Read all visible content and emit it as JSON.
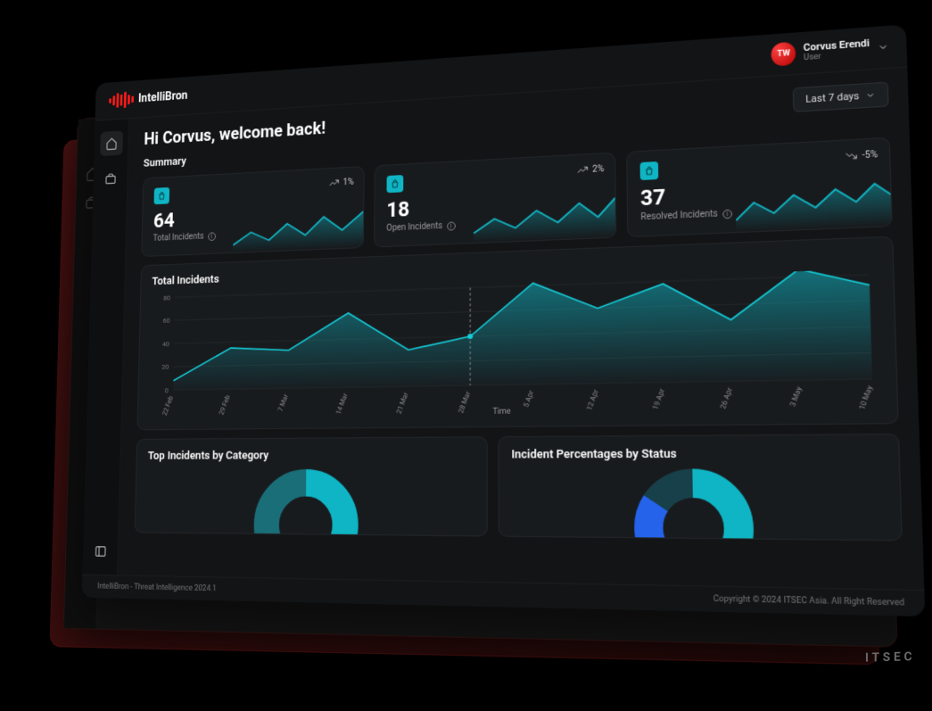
{
  "brand": {
    "name": "IntelliBron"
  },
  "user": {
    "initials": "TW",
    "name": "Corvus Erendi",
    "role": "User"
  },
  "range": {
    "label": "Last 7 days"
  },
  "welcome": "Hi Corvus, welcome back!",
  "summary": {
    "heading": "Summary",
    "cards": [
      {
        "value": "64",
        "label": "Total Incidents",
        "trend": "1%",
        "trend_dir": "up"
      },
      {
        "value": "18",
        "label": "Open Incidents",
        "trend": "2%",
        "trend_dir": "up"
      },
      {
        "value": "37",
        "label": "Resolved Incidents",
        "trend": "-5%",
        "trend_dir": "down"
      }
    ]
  },
  "chart": {
    "title": "Total Incidents",
    "xlabel": "Time"
  },
  "chart_data": {
    "type": "area",
    "title": "Total Incidents",
    "xlabel": "Time",
    "ylabel": "",
    "ylim": [
      0,
      80
    ],
    "y_ticks": [
      0,
      20,
      40,
      60,
      80
    ],
    "categories": [
      "22 Feb",
      "29 Feb",
      "7 Mar",
      "14 Mar",
      "21 Mar",
      "28 Mar",
      "5 Apr",
      "12 Apr",
      "19 Apr",
      "26 Apr",
      "3 May",
      "10 May"
    ],
    "values": [
      8,
      35,
      32,
      62,
      30,
      40,
      82,
      60,
      78,
      48,
      86,
      72
    ]
  },
  "panels": {
    "left": "Top Incidents by Category",
    "right": "Incident Percentages by Status"
  },
  "footer": {
    "left": "IntelliBron - Threat Intelligence 2024.1",
    "right": "Copyright © 2024 ITSEC Asia. All Right Reserved"
  },
  "corp_logo": "ITSEC"
}
